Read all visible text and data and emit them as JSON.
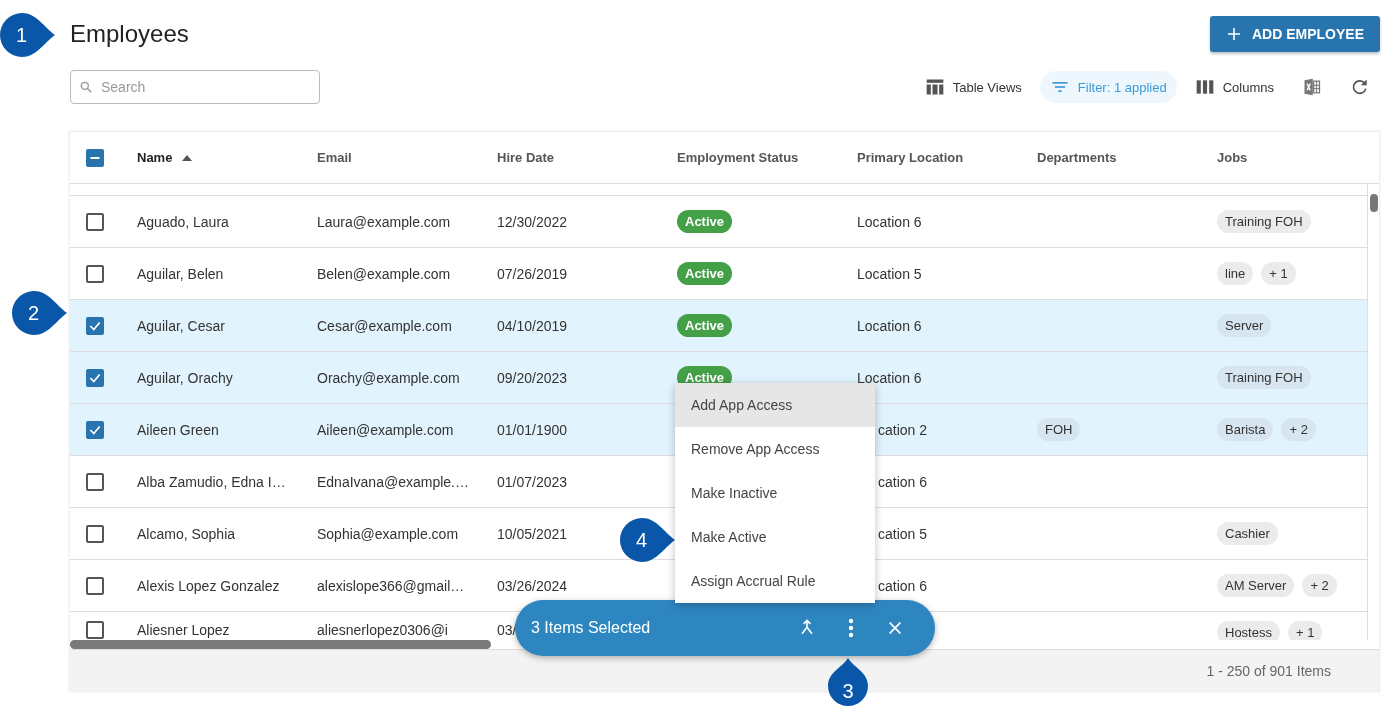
{
  "page": {
    "title": "Employees",
    "add_button": "ADD EMPLOYEE"
  },
  "search": {
    "placeholder": "Search"
  },
  "toolbar": [
    {
      "kind": "views",
      "label": "Table Views",
      "active": false
    },
    {
      "kind": "filter",
      "label": "Filter: 1 applied",
      "active": true
    },
    {
      "kind": "columns",
      "label": "Columns",
      "active": false
    },
    {
      "kind": "excel"
    },
    {
      "kind": "refresh"
    }
  ],
  "table": {
    "select_all_partial": true,
    "columns": [
      {
        "label": "Name",
        "sort_ascending": true
      },
      {
        "label": "Email"
      },
      {
        "label": "Hire Date"
      },
      {
        "label": "Employment Status"
      },
      {
        "label": "Primary Location"
      },
      {
        "label": "Departments"
      },
      {
        "label": "Jobs"
      }
    ],
    "rows": [
      {
        "selected": false,
        "name": "Aguado, Laura",
        "email": "Laura@example.com",
        "hire_date": "12/30/2022",
        "status": {
          "kind": "active",
          "label": "Active"
        },
        "location": "Location 6",
        "jobs": [
          "Training FOH"
        ]
      },
      {
        "selected": false,
        "name": "Aguilar, Belen",
        "email": "Belen@example.com",
        "hire_date": "07/26/2019",
        "status": {
          "kind": "active",
          "label": "Active"
        },
        "location": "Location 5",
        "jobs": [
          "line",
          "+ 1"
        ]
      },
      {
        "selected": true,
        "name": "Aguilar, Cesar",
        "email": "Cesar@example.com",
        "hire_date": "04/10/2019",
        "status": {
          "kind": "active",
          "label": "Active"
        },
        "location": "Location 6",
        "jobs": [
          "Server"
        ]
      },
      {
        "selected": true,
        "name": "Aguilar, Orachy",
        "email": "Orachy@example.com",
        "hire_date": "09/20/2023",
        "status": {
          "kind": "active",
          "label": "Active"
        },
        "location": "Location 6",
        "jobs": [
          "Training FOH"
        ]
      },
      {
        "selected": true,
        "name": "Aileen Green",
        "email": "Aileen@example.com",
        "hire_date": "01/01/1900",
        "location": "cation 2",
        "location_covered": true,
        "departments": [
          "FOH"
        ],
        "jobs": [
          "Barista",
          "+ 2"
        ]
      },
      {
        "selected": false,
        "name": "Alba Zamudio, Edna I…",
        "email": "EdnaIvana@example.…",
        "hire_date": "01/07/2023",
        "location": "cation 6",
        "location_covered": true
      },
      {
        "selected": false,
        "name": "Alcamo, Sophia",
        "email": "Sophia@example.com",
        "hire_date": "10/05/2021",
        "location": "cation 5",
        "location_covered": true,
        "jobs": [
          "Cashier"
        ]
      },
      {
        "selected": false,
        "name": "Alexis Lopez Gonzalez",
        "email": "alexislope366@gmail…",
        "hire_date": "03/26/2024",
        "location": "cation 6",
        "location_covered": true,
        "jobs": [
          "AM Server",
          "+ 2"
        ]
      },
      {
        "selected": false,
        "name": "Aliesner Lopez",
        "email": "aliesnerlopez0306@i",
        "hire_date": "03/",
        "jobs": [
          "Hostess",
          "+ 1"
        ]
      }
    ],
    "footer": "1 - 250 of 901 Items"
  },
  "menu": [
    {
      "label": "Add App Access",
      "highlighted": true
    },
    {
      "label": "Remove App Access",
      "highlighted": false
    },
    {
      "label": "Make Inactive",
      "highlighted": false
    },
    {
      "label": "Make Active",
      "highlighted": false
    },
    {
      "label": "Assign Accrual Rule",
      "highlighted": false
    }
  ],
  "selection_bar": {
    "label": "3 Items Selected"
  },
  "callouts": [
    {
      "number": "1",
      "kind": "right"
    },
    {
      "number": "2",
      "kind": "right"
    },
    {
      "number": "3",
      "kind": "up"
    },
    {
      "number": "4",
      "kind": "right"
    }
  ]
}
